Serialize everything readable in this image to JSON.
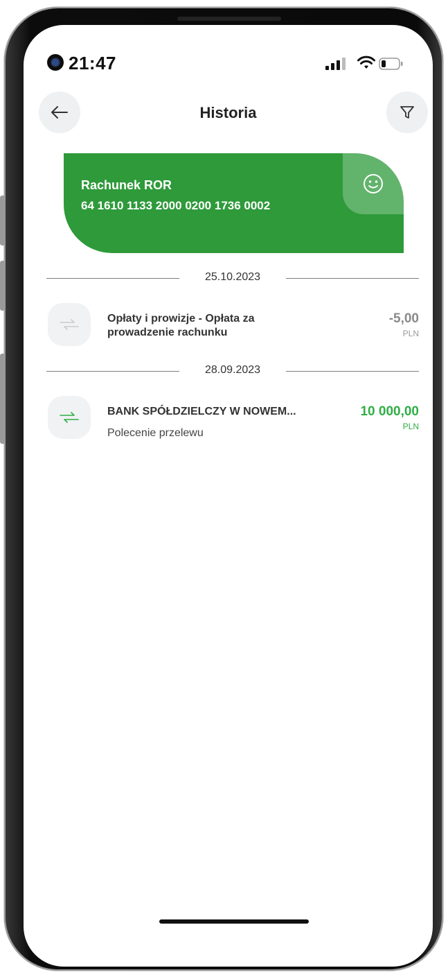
{
  "status_bar": {
    "time": "21:47"
  },
  "header": {
    "title": "Historia"
  },
  "account": {
    "name": "Rachunek ROR",
    "number": "64 1610 1133 2000 0200 1736 0002"
  },
  "groups": [
    {
      "date": "25.10.2023",
      "transactions": [
        {
          "title_line1": "Opłaty i prowizje - Opłata za",
          "title_line2": "prowadzenie rachunku",
          "amount": "-5,00",
          "currency": "PLN"
        }
      ]
    },
    {
      "date": "28.09.2023",
      "transactions": [
        {
          "title_line1": "BANK SPÓŁDZIELCZY W NOWEM...",
          "subtitle": "Polecenie przelewu",
          "amount": "10 000,00",
          "currency": "PLN"
        }
      ]
    }
  ],
  "colors": {
    "brand_green": "#2e9a3a",
    "amount_positive": "#2fae45",
    "amount_neutral": "#8a8a8a"
  },
  "icons": {
    "back": "arrow-left-icon",
    "filter": "filter-icon",
    "card": "smiley-icon",
    "transaction": "transfer-arrows-icon"
  }
}
